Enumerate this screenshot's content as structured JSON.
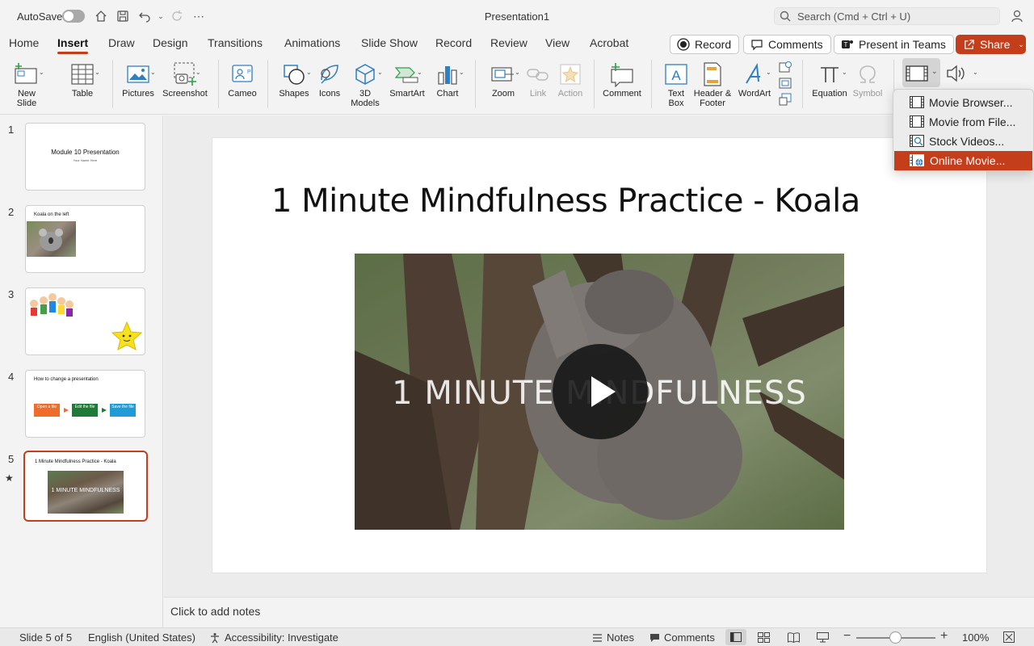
{
  "titlebar": {
    "autosave_label": "AutoSave",
    "title": "Presentation1",
    "search_placeholder": "Search (Cmd + Ctrl + U)"
  },
  "tabs": [
    "Home",
    "Insert",
    "Draw",
    "Design",
    "Transitions",
    "Animations",
    "Slide Show",
    "Record",
    "Review",
    "View",
    "Acrobat"
  ],
  "active_tab": "Insert",
  "tab_buttons": {
    "record": "Record",
    "comments": "Comments",
    "present_teams": "Present in Teams",
    "share": "Share"
  },
  "ribbon": {
    "new_slide": "New\nSlide",
    "table": "Table",
    "pictures": "Pictures",
    "screenshot": "Screenshot",
    "cameo": "Cameo",
    "shapes": "Shapes",
    "icons": "Icons",
    "models3d": "3D\nModels",
    "smartart": "SmartArt",
    "chart": "Chart",
    "zoom": "Zoom",
    "link": "Link",
    "action": "Action",
    "comment": "Comment",
    "textbox": "Text\nBox",
    "header_footer": "Header &\nFooter",
    "wordart": "WordArt",
    "equation": "Equation",
    "symbol": "Symbol"
  },
  "media_menu": {
    "items": [
      {
        "label": "Movie Browser...",
        "icon": "film-icon"
      },
      {
        "label": "Movie from File...",
        "icon": "film-icon"
      },
      {
        "label": "Stock Videos...",
        "icon": "stock-video-icon"
      },
      {
        "label": "Online Movie...",
        "icon": "online-movie-icon"
      }
    ],
    "highlighted_index": 3
  },
  "thumbnails": [
    {
      "number": "1",
      "title": "Module 10 Presentation",
      "subtitle": "Your Name Here"
    },
    {
      "number": "2",
      "title": "Koala on the left"
    },
    {
      "number": "3"
    },
    {
      "number": "4",
      "title": "How to change a presentation",
      "steps": [
        "Open a file",
        "Edit the file",
        "Save the file"
      ]
    },
    {
      "number": "5",
      "title": "1 Minute Mindfulness Practice - Koala",
      "video_text": "1 MINUTE MINDFULNESS"
    }
  ],
  "selected_slide": 5,
  "slide": {
    "title": "1 Minute Mindfulness Practice - Koala",
    "video_overlay_text": "1 MINUTE MINDFULNESS"
  },
  "notes_placeholder": "Click to add notes",
  "status": {
    "slide_info": "Slide 5 of 5",
    "language": "English (United States)",
    "accessibility": "Accessibility: Investigate",
    "notes": "Notes",
    "comments": "Comments",
    "zoom": "100%"
  },
  "colors": {
    "accent": "#c43e1c",
    "ribbon_icon_blue": "#2f7fc1"
  }
}
